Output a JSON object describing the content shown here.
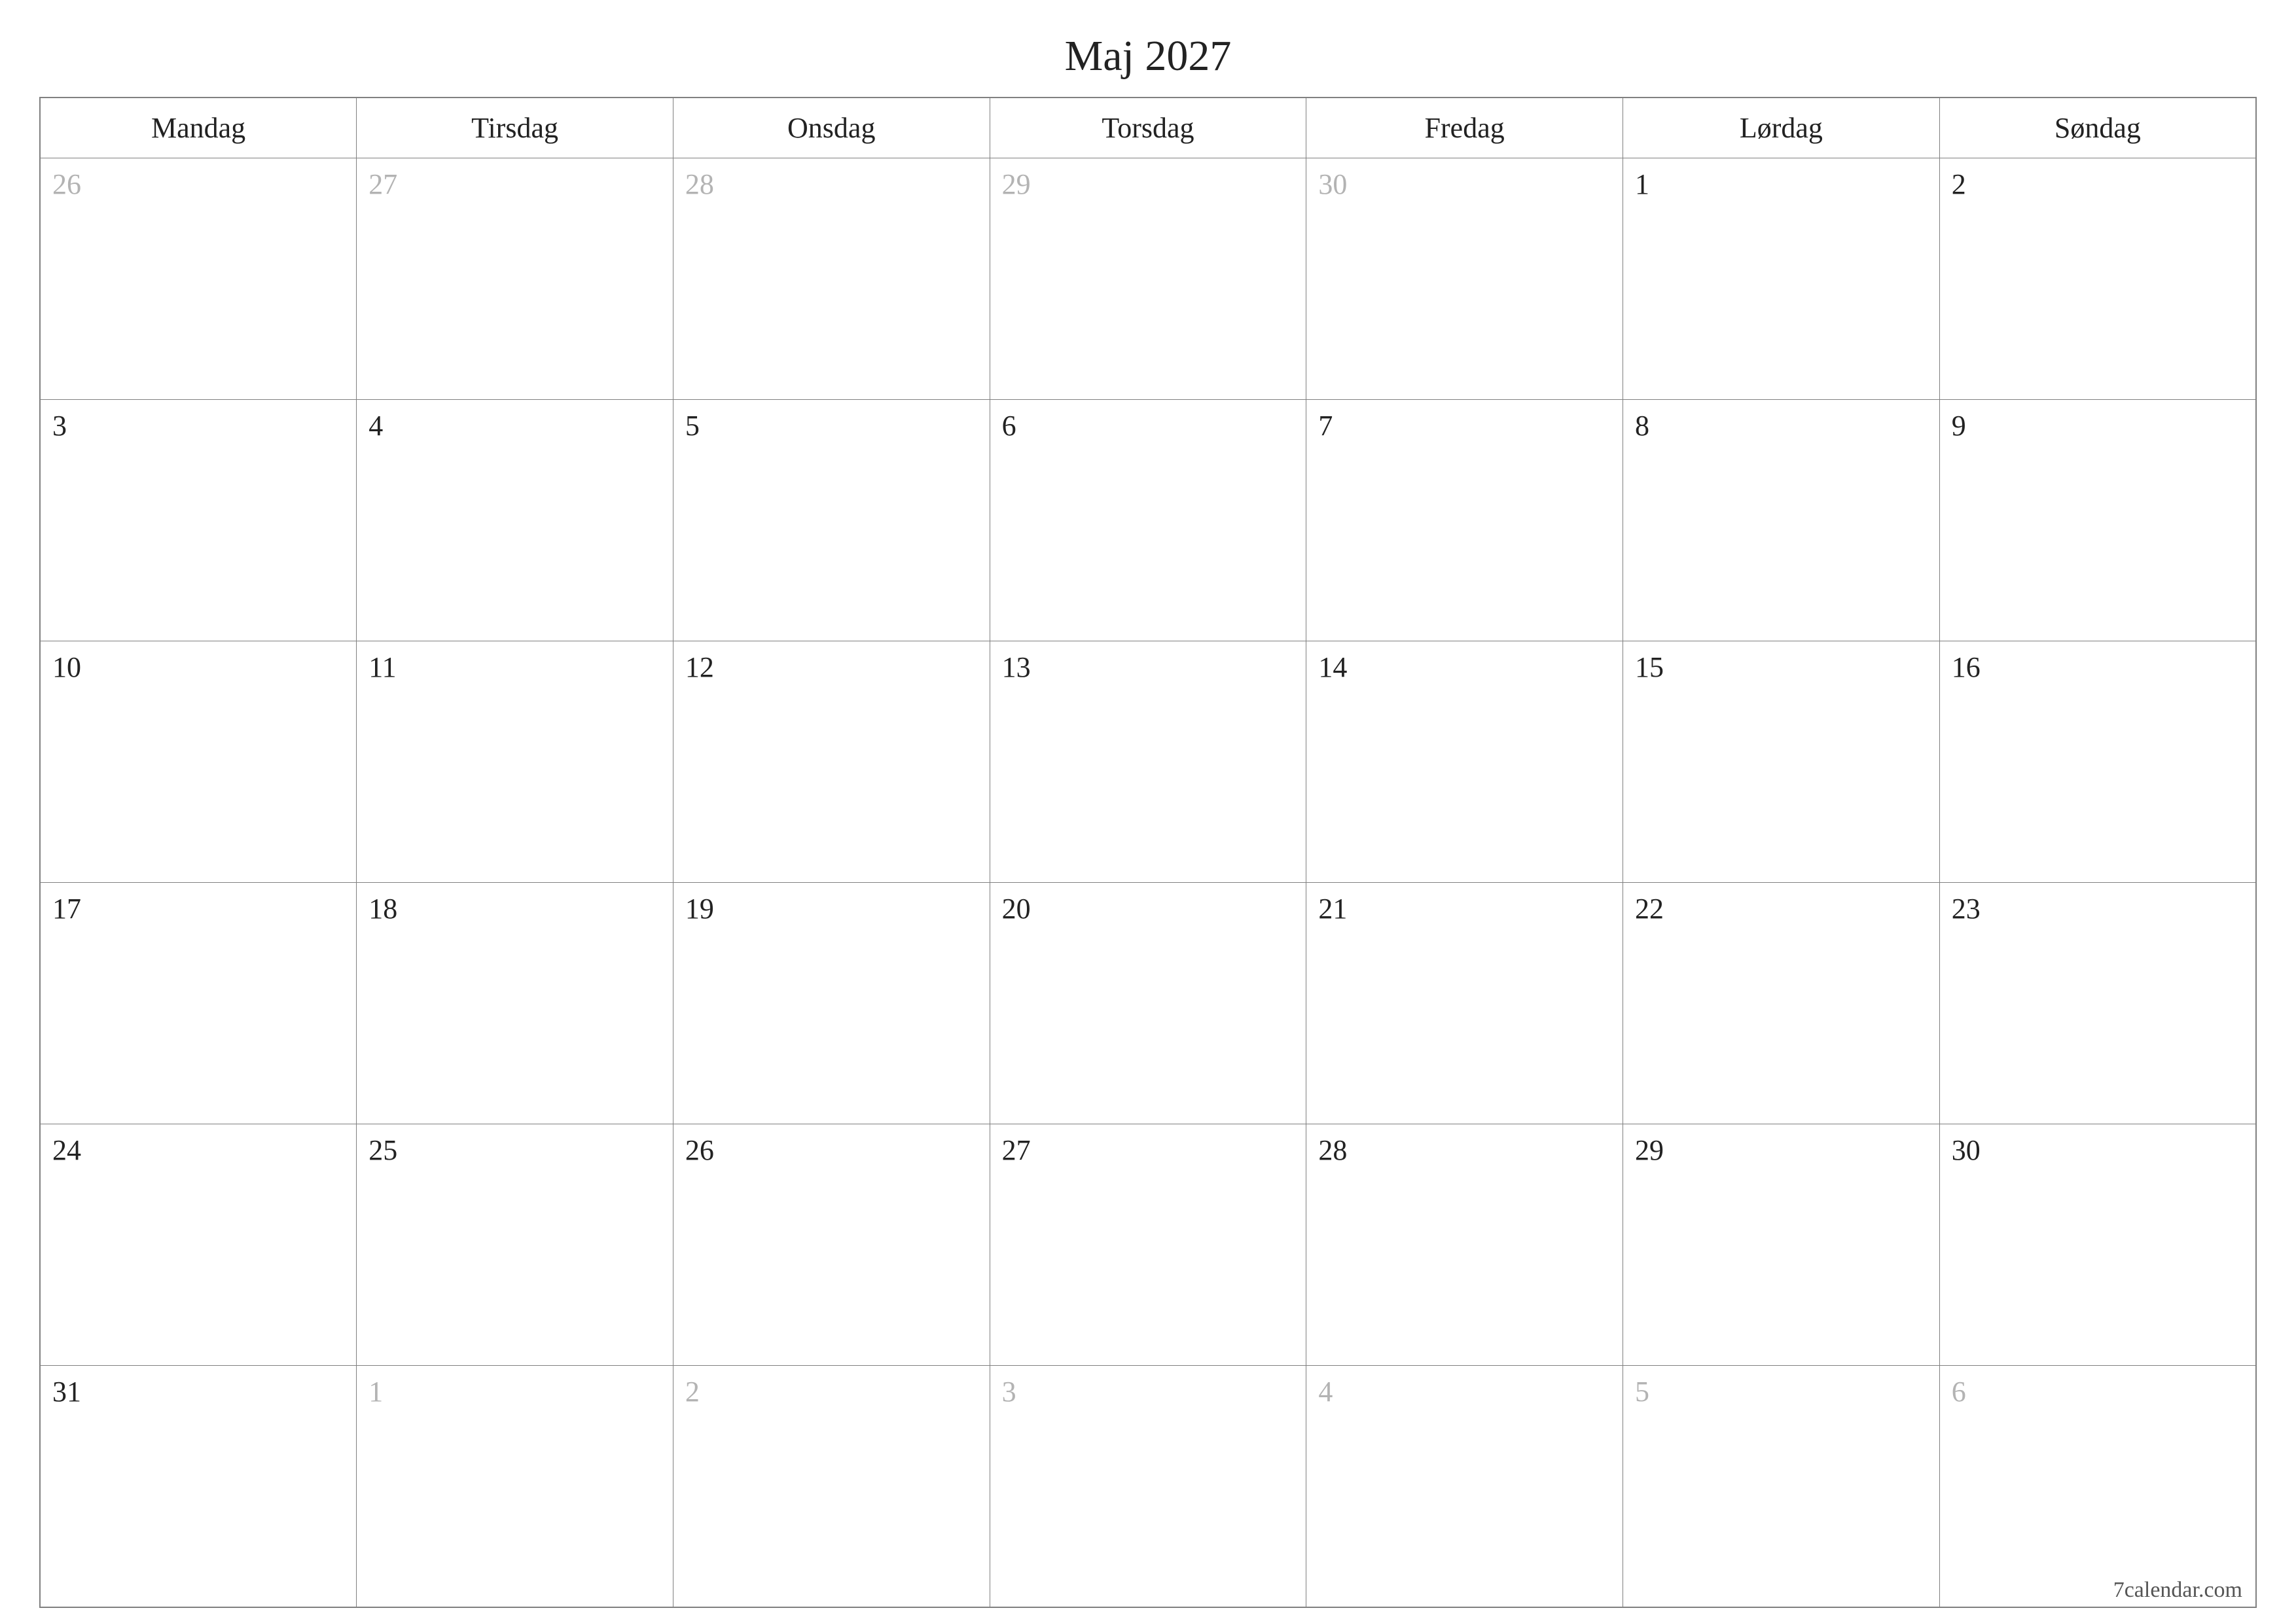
{
  "title": "Maj 2027",
  "weekdays": [
    "Mandag",
    "Tirsdag",
    "Onsdag",
    "Torsdag",
    "Fredag",
    "Lørdag",
    "Søndag"
  ],
  "weeks": [
    [
      {
        "day": "26",
        "muted": true
      },
      {
        "day": "27",
        "muted": true
      },
      {
        "day": "28",
        "muted": true
      },
      {
        "day": "29",
        "muted": true
      },
      {
        "day": "30",
        "muted": true
      },
      {
        "day": "1",
        "muted": false
      },
      {
        "day": "2",
        "muted": false
      }
    ],
    [
      {
        "day": "3",
        "muted": false
      },
      {
        "day": "4",
        "muted": false
      },
      {
        "day": "5",
        "muted": false
      },
      {
        "day": "6",
        "muted": false
      },
      {
        "day": "7",
        "muted": false
      },
      {
        "day": "8",
        "muted": false
      },
      {
        "day": "9",
        "muted": false
      }
    ],
    [
      {
        "day": "10",
        "muted": false
      },
      {
        "day": "11",
        "muted": false
      },
      {
        "day": "12",
        "muted": false
      },
      {
        "day": "13",
        "muted": false
      },
      {
        "day": "14",
        "muted": false
      },
      {
        "day": "15",
        "muted": false
      },
      {
        "day": "16",
        "muted": false
      }
    ],
    [
      {
        "day": "17",
        "muted": false
      },
      {
        "day": "18",
        "muted": false
      },
      {
        "day": "19",
        "muted": false
      },
      {
        "day": "20",
        "muted": false
      },
      {
        "day": "21",
        "muted": false
      },
      {
        "day": "22",
        "muted": false
      },
      {
        "day": "23",
        "muted": false
      }
    ],
    [
      {
        "day": "24",
        "muted": false
      },
      {
        "day": "25",
        "muted": false
      },
      {
        "day": "26",
        "muted": false
      },
      {
        "day": "27",
        "muted": false
      },
      {
        "day": "28",
        "muted": false
      },
      {
        "day": "29",
        "muted": false
      },
      {
        "day": "30",
        "muted": false
      }
    ],
    [
      {
        "day": "31",
        "muted": false
      },
      {
        "day": "1",
        "muted": true
      },
      {
        "day": "2",
        "muted": true
      },
      {
        "day": "3",
        "muted": true
      },
      {
        "day": "4",
        "muted": true
      },
      {
        "day": "5",
        "muted": true
      },
      {
        "day": "6",
        "muted": true
      }
    ]
  ],
  "footer": "7calendar.com"
}
